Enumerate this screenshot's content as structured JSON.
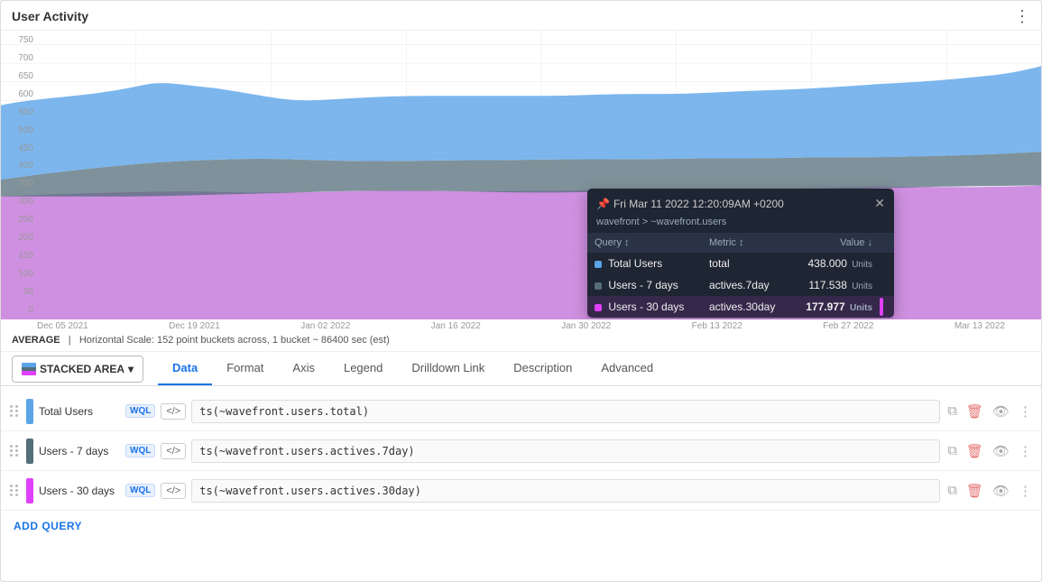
{
  "panel": {
    "title": "User Activity",
    "menu_icon": "⋮"
  },
  "chart": {
    "type": "STACKED AREA",
    "stats": "AVERAGE  |  Horizontal Scale: 152 point buckets across, 1 bucket ~ 86400 sec (est)",
    "avg_label": "AVERAGE",
    "scale_text": "Horizontal Scale: 152 point buckets across, 1 bucket ~ 86400 sec (est)",
    "y_labels": [
      "750",
      "700",
      "650",
      "600",
      "550",
      "500",
      "450",
      "400",
      "350",
      "300",
      "250",
      "200",
      "150",
      "100",
      "50",
      "0"
    ],
    "x_labels": [
      "Dec 05 2021",
      "Dec 19 2021",
      "Jan 02 2022",
      "Jan 16 2022",
      "Jan 30 2022",
      "Feb 13 2022",
      "Feb 27 2022",
      "Mar 13 2022"
    ]
  },
  "tooltip": {
    "timestamp": "Fri Mar 11 2022 12:20:09AM +0200",
    "pin_icon": "📌",
    "source": "wavefront > ~wavefront.users",
    "close_icon": "✕",
    "columns": {
      "query": "Query",
      "metric": "Metric",
      "value": "Value"
    },
    "rows": [
      {
        "color": "#5ba4e8",
        "query": "Total Users",
        "metric": "total",
        "value": "438.000",
        "unit": "Units"
      },
      {
        "color": "#546e7a",
        "query": "Users - 7 days",
        "metric": "actives.7day",
        "value": "117.538",
        "unit": "Units"
      },
      {
        "color": "#e040fb",
        "query": "Users - 30 days",
        "metric": "actives.30day",
        "value": "177.977",
        "unit": "Units"
      }
    ]
  },
  "tabs": {
    "items": [
      "Data",
      "Format",
      "Axis",
      "Legend",
      "Drilldown Link",
      "Description",
      "Advanced"
    ]
  },
  "queries": [
    {
      "id": 1,
      "name": "Total Users",
      "color": "#5ba4e8",
      "wql": "WQL",
      "code": "</>",
      "expression": "ts(~wavefront.users.total)"
    },
    {
      "id": 2,
      "name": "Users - 7 days",
      "color": "#546e7a",
      "wql": "WQL",
      "code": "</>",
      "expression": "ts(~wavefront.users.actives.7day)"
    },
    {
      "id": 3,
      "name": "Users - 30 days",
      "color": "#e040fb",
      "wql": "WQL",
      "code": "</>",
      "expression": "ts(~wavefront.users.actives.30day)"
    }
  ],
  "add_query_label": "ADD QUERY",
  "icons": {
    "drag": "⠿",
    "copy": "⧉",
    "delete": "🗑",
    "eye": "👁",
    "more": "⋮"
  }
}
